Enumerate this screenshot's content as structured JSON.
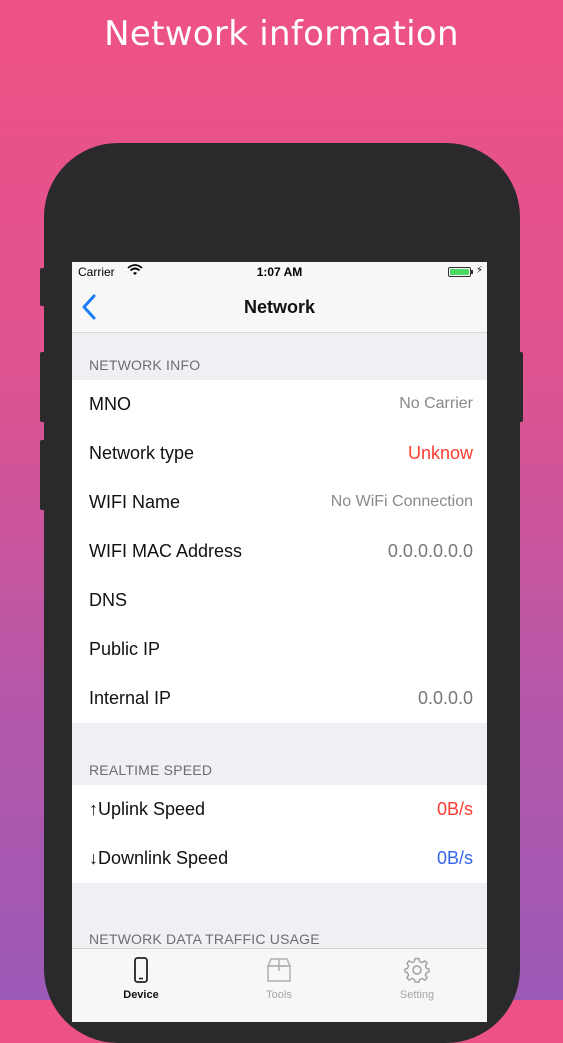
{
  "headline": "Network information",
  "status_bar": {
    "carrier": "Carrier",
    "time": "1:07 AM"
  },
  "nav": {
    "title": "Network"
  },
  "sections": {
    "network_info": {
      "header": "NETWORK INFO",
      "rows": [
        {
          "label": "MNO",
          "value": "No Carrier"
        },
        {
          "label": "Network type",
          "value": "Unknow"
        },
        {
          "label": "WIFI Name",
          "value": "No WiFi Connection"
        },
        {
          "label": "WIFI MAC Address",
          "value": "0.0.0.0.0.0"
        },
        {
          "label": "DNS",
          "value": ""
        },
        {
          "label": "Public IP",
          "value": ""
        },
        {
          "label": "Internal IP",
          "value": "0.0.0.0"
        }
      ]
    },
    "realtime_speed": {
      "header": "REALTIME SPEED",
      "rows": [
        {
          "label": "↑Uplink Speed",
          "value": "0B/s"
        },
        {
          "label": "↓Downlink Speed",
          "value": "0B/s"
        }
      ]
    },
    "traffic_usage": {
      "header": "NETWORK DATA TRAFFIC USAGE"
    }
  },
  "tabs": [
    {
      "label": "Device",
      "icon": "phone-icon"
    },
    {
      "label": "Tools",
      "icon": "box-icon"
    },
    {
      "label": "Setting",
      "icon": "gear-icon"
    }
  ],
  "colors": {
    "accent_red": "#ff3b30",
    "accent_blue": "#3366ee",
    "ios_blue": "#1a7cf5",
    "battery_green": "#4cd964"
  }
}
